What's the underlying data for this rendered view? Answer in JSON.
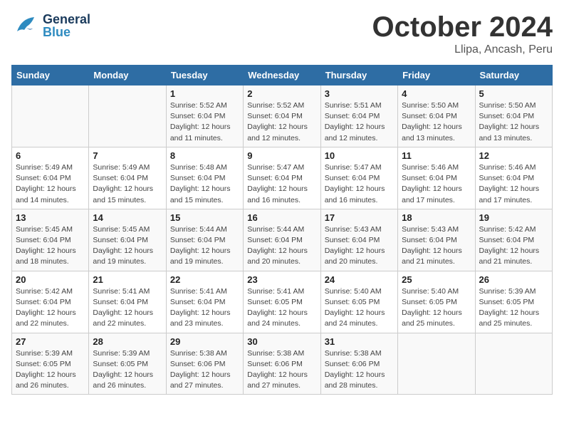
{
  "header": {
    "logo_general": "General",
    "logo_blue": "Blue",
    "title": "October 2024",
    "subtitle": "Llipa, Ancash, Peru"
  },
  "weekdays": [
    "Sunday",
    "Monday",
    "Tuesday",
    "Wednesday",
    "Thursday",
    "Friday",
    "Saturday"
  ],
  "weeks": [
    [
      {
        "day": "",
        "info": ""
      },
      {
        "day": "",
        "info": ""
      },
      {
        "day": "1",
        "info": "Sunrise: 5:52 AM\nSunset: 6:04 PM\nDaylight: 12 hours\nand 11 minutes."
      },
      {
        "day": "2",
        "info": "Sunrise: 5:52 AM\nSunset: 6:04 PM\nDaylight: 12 hours\nand 12 minutes."
      },
      {
        "day": "3",
        "info": "Sunrise: 5:51 AM\nSunset: 6:04 PM\nDaylight: 12 hours\nand 12 minutes."
      },
      {
        "day": "4",
        "info": "Sunrise: 5:50 AM\nSunset: 6:04 PM\nDaylight: 12 hours\nand 13 minutes."
      },
      {
        "day": "5",
        "info": "Sunrise: 5:50 AM\nSunset: 6:04 PM\nDaylight: 12 hours\nand 13 minutes."
      }
    ],
    [
      {
        "day": "6",
        "info": "Sunrise: 5:49 AM\nSunset: 6:04 PM\nDaylight: 12 hours\nand 14 minutes."
      },
      {
        "day": "7",
        "info": "Sunrise: 5:49 AM\nSunset: 6:04 PM\nDaylight: 12 hours\nand 15 minutes."
      },
      {
        "day": "8",
        "info": "Sunrise: 5:48 AM\nSunset: 6:04 PM\nDaylight: 12 hours\nand 15 minutes."
      },
      {
        "day": "9",
        "info": "Sunrise: 5:47 AM\nSunset: 6:04 PM\nDaylight: 12 hours\nand 16 minutes."
      },
      {
        "day": "10",
        "info": "Sunrise: 5:47 AM\nSunset: 6:04 PM\nDaylight: 12 hours\nand 16 minutes."
      },
      {
        "day": "11",
        "info": "Sunrise: 5:46 AM\nSunset: 6:04 PM\nDaylight: 12 hours\nand 17 minutes."
      },
      {
        "day": "12",
        "info": "Sunrise: 5:46 AM\nSunset: 6:04 PM\nDaylight: 12 hours\nand 17 minutes."
      }
    ],
    [
      {
        "day": "13",
        "info": "Sunrise: 5:45 AM\nSunset: 6:04 PM\nDaylight: 12 hours\nand 18 minutes."
      },
      {
        "day": "14",
        "info": "Sunrise: 5:45 AM\nSunset: 6:04 PM\nDaylight: 12 hours\nand 19 minutes."
      },
      {
        "day": "15",
        "info": "Sunrise: 5:44 AM\nSunset: 6:04 PM\nDaylight: 12 hours\nand 19 minutes."
      },
      {
        "day": "16",
        "info": "Sunrise: 5:44 AM\nSunset: 6:04 PM\nDaylight: 12 hours\nand 20 minutes."
      },
      {
        "day": "17",
        "info": "Sunrise: 5:43 AM\nSunset: 6:04 PM\nDaylight: 12 hours\nand 20 minutes."
      },
      {
        "day": "18",
        "info": "Sunrise: 5:43 AM\nSunset: 6:04 PM\nDaylight: 12 hours\nand 21 minutes."
      },
      {
        "day": "19",
        "info": "Sunrise: 5:42 AM\nSunset: 6:04 PM\nDaylight: 12 hours\nand 21 minutes."
      }
    ],
    [
      {
        "day": "20",
        "info": "Sunrise: 5:42 AM\nSunset: 6:04 PM\nDaylight: 12 hours\nand 22 minutes."
      },
      {
        "day": "21",
        "info": "Sunrise: 5:41 AM\nSunset: 6:04 PM\nDaylight: 12 hours\nand 22 minutes."
      },
      {
        "day": "22",
        "info": "Sunrise: 5:41 AM\nSunset: 6:04 PM\nDaylight: 12 hours\nand 23 minutes."
      },
      {
        "day": "23",
        "info": "Sunrise: 5:41 AM\nSunset: 6:05 PM\nDaylight: 12 hours\nand 24 minutes."
      },
      {
        "day": "24",
        "info": "Sunrise: 5:40 AM\nSunset: 6:05 PM\nDaylight: 12 hours\nand 24 minutes."
      },
      {
        "day": "25",
        "info": "Sunrise: 5:40 AM\nSunset: 6:05 PM\nDaylight: 12 hours\nand 25 minutes."
      },
      {
        "day": "26",
        "info": "Sunrise: 5:39 AM\nSunset: 6:05 PM\nDaylight: 12 hours\nand 25 minutes."
      }
    ],
    [
      {
        "day": "27",
        "info": "Sunrise: 5:39 AM\nSunset: 6:05 PM\nDaylight: 12 hours\nand 26 minutes."
      },
      {
        "day": "28",
        "info": "Sunrise: 5:39 AM\nSunset: 6:05 PM\nDaylight: 12 hours\nand 26 minutes."
      },
      {
        "day": "29",
        "info": "Sunrise: 5:38 AM\nSunset: 6:06 PM\nDaylight: 12 hours\nand 27 minutes."
      },
      {
        "day": "30",
        "info": "Sunrise: 5:38 AM\nSunset: 6:06 PM\nDaylight: 12 hours\nand 27 minutes."
      },
      {
        "day": "31",
        "info": "Sunrise: 5:38 AM\nSunset: 6:06 PM\nDaylight: 12 hours\nand 28 minutes."
      },
      {
        "day": "",
        "info": ""
      },
      {
        "day": "",
        "info": ""
      }
    ]
  ]
}
